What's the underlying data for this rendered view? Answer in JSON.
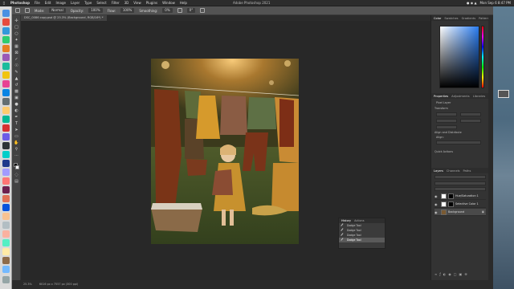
{
  "menubar": {
    "app": "Photoshop",
    "items": [
      "File",
      "Edit",
      "Image",
      "Layer",
      "Type",
      "Select",
      "Filter",
      "3D",
      "View",
      "Plugins",
      "Window",
      "Help"
    ],
    "window_title": "Adobe Photoshop 2021",
    "clock": "Mon Sep 6  8:47 PM"
  },
  "options_bar": {
    "mode_label": "Mode:",
    "mode_value": "Normal",
    "opacity_label": "Opacity:",
    "opacity_value": "100%",
    "flow_label": "Flow:",
    "flow_value": "100%",
    "smoothing_label": "Smoothing:",
    "smoothing_value": "0%",
    "angle_value": "0°"
  },
  "document": {
    "tab_label": "DSC_0086 copy.psd @ 25.3% (Background, RGB/16*) *",
    "zoom": "25.3%",
    "status": "6016 px x 7557 px (300 ppi)"
  },
  "color_panel": {
    "tabs": [
      "Color",
      "Swatches",
      "Gradients",
      "Patterns"
    ]
  },
  "properties_panel": {
    "tabs": [
      "Properties",
      "Adjustments",
      "Libraries"
    ],
    "section_pixel": "Pixel Layer",
    "transform": "Transform",
    "align": "Align and Distribute",
    "align_sub": "Align:",
    "quick_actions": "Quick Actions"
  },
  "layers_panel": {
    "tabs": [
      "Layers",
      "Channels",
      "Paths"
    ],
    "layers": [
      {
        "name": "Hue/Saturation 1",
        "type": "adjustment"
      },
      {
        "name": "Selective Color 1",
        "type": "adjustment"
      },
      {
        "name": "Background",
        "type": "image"
      }
    ]
  },
  "history_panel": {
    "tabs": [
      "History",
      "Actions"
    ],
    "items": [
      "Dodge Tool",
      "Dodge Tool",
      "Dodge Tool",
      "Dodge Tool"
    ],
    "selected_index": 3
  }
}
